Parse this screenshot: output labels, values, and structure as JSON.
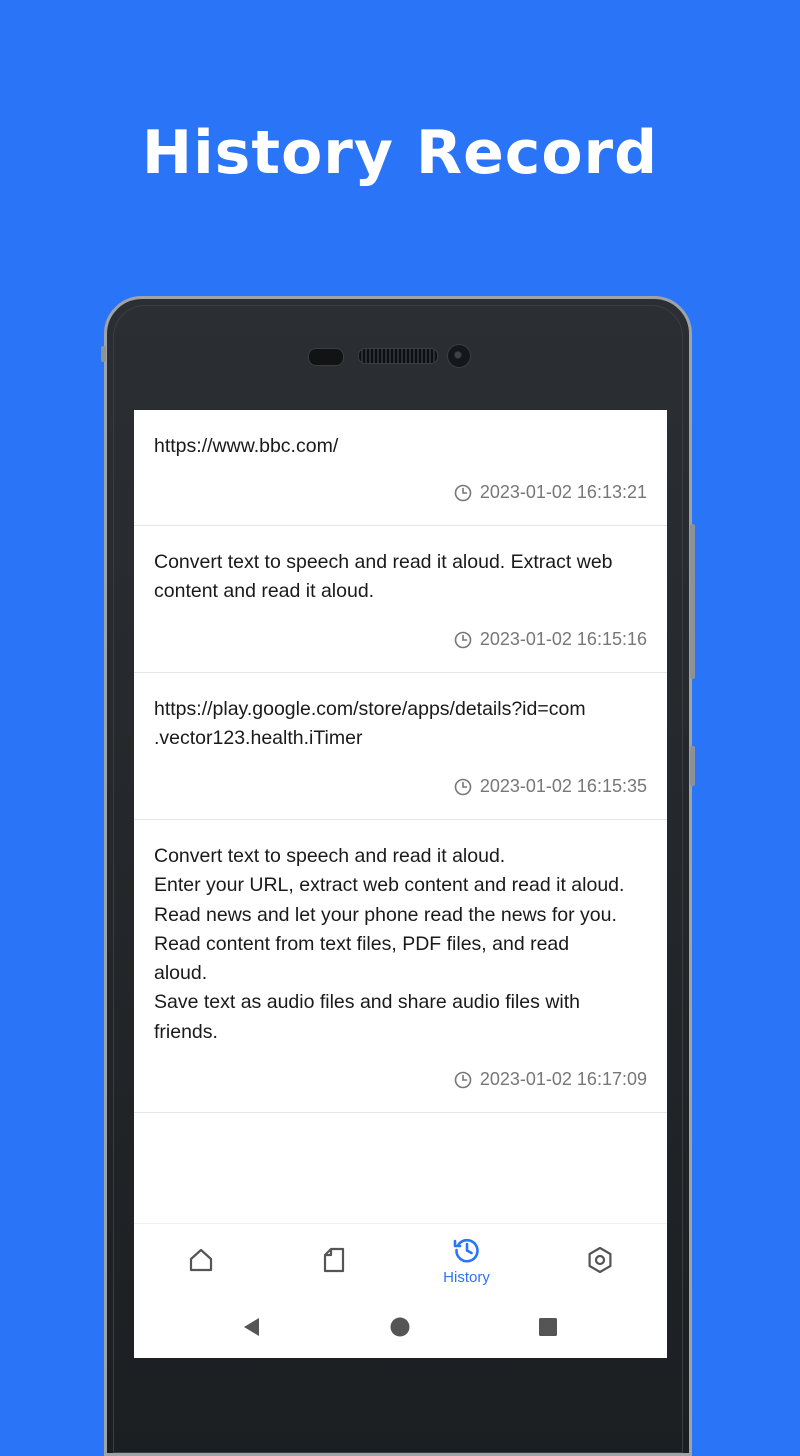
{
  "headline": "History Record",
  "history": [
    {
      "text": "https://www.bbc.com/",
      "time": "2023-01-02 16:13:21"
    },
    {
      "text": "Convert text to speech and read it aloud. Extract web\ncontent and read it aloud.",
      "time": "2023-01-02 16:15:16"
    },
    {
      "text": "https://play.google.com/store/apps/details?id=com\n.vector123.health.iTimer",
      "time": "2023-01-02 16:15:35"
    },
    {
      "text": "Convert text to speech and read it aloud.\nEnter your URL, extract web content and read it aloud.\nRead news and let your phone read the news for you.\nRead content from text files, PDF files, and read\naloud.\nSave text as audio files and share audio files with\nfriends.",
      "time": "2023-01-02 16:17:09"
    }
  ],
  "bottom_nav": [
    {
      "icon": "home-icon",
      "label": "",
      "active": false
    },
    {
      "icon": "document-icon",
      "label": "",
      "active": false
    },
    {
      "icon": "history-icon",
      "label": "History",
      "active": true
    },
    {
      "icon": "settings-icon",
      "label": "",
      "active": false
    }
  ],
  "colors": {
    "background": "#2a74f8",
    "accent": "#2a74f8",
    "icon_inactive": "#555555",
    "timestamp": "#777777"
  }
}
